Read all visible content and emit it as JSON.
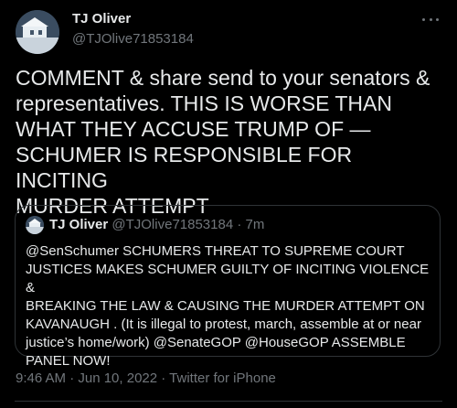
{
  "author": {
    "name": "TJ Oliver",
    "handle": "@TJOlive71853184"
  },
  "tweet": {
    "text": "COMMENT  & share send to your senators &\nrepresentatives.  THIS IS WORSE THAN\nWHAT THEY ACCUSE TRUMP OF —\nSCHUMER IS RESPONSIBLE FOR INCITING\nMURDER ATTEMPT"
  },
  "quote": {
    "name": "TJ Oliver",
    "handle": "@TJOlive71853184",
    "separator": "·",
    "time": "7m",
    "text": "@SenSchumer SCHUMERS THREAT TO SUPREME COURT\nJUSTICES MAKES SCHUMER GUILTY OF INCITING  VIOLENCE &\nBREAKING THE LAW & CAUSING THE MURDER ATTEMPT ON\nKAVANAUGH .  (It is illegal to protest, march, assemble at or near\njustice’s home/work) @SenateGOP @HouseGOP ASSEMBLE\nPANEL NOW!"
  },
  "meta": {
    "line": "9:46 AM · Jun 10, 2022 · Twitter for iPhone"
  },
  "icons": {
    "more": "more-options-icon"
  },
  "colors": {
    "background": "#000000",
    "text": "#e7e9ea",
    "secondary": "#71767b",
    "border": "#2f3336"
  }
}
